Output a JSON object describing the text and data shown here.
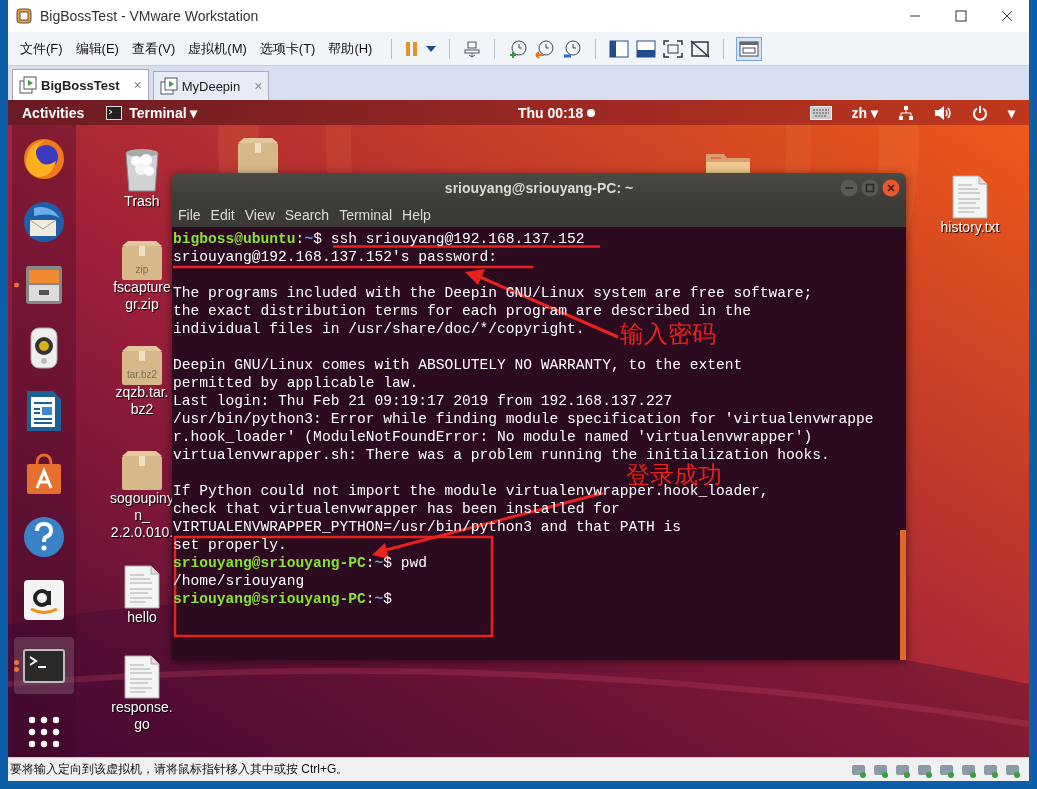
{
  "window": {
    "title": "BigBossTest - VMware Workstation"
  },
  "menu": [
    {
      "label": "文件(F)"
    },
    {
      "label": "编辑(E)"
    },
    {
      "label": "查看(V)"
    },
    {
      "label": "虚拟机(M)"
    },
    {
      "label": "选项卡(T)"
    },
    {
      "label": "帮助(H)"
    }
  ],
  "tabs": [
    {
      "label": "BigBossTest",
      "selected": true,
      "close": "×"
    },
    {
      "label": "MyDeepin",
      "selected": false,
      "close": "×"
    }
  ],
  "top_bar": {
    "activities": "Activities",
    "app_menu": "Terminal",
    "caret": "▾",
    "clock": "Thu 00:18",
    "input_method": "zh"
  },
  "dock": [
    {
      "kind": "firefox",
      "running": false,
      "active": false
    },
    {
      "kind": "mail",
      "running": false,
      "active": false
    },
    {
      "kind": "files",
      "running": true,
      "active": false
    },
    {
      "kind": "speaker",
      "running": false,
      "active": false
    },
    {
      "kind": "writer",
      "running": false,
      "active": false
    },
    {
      "kind": "store",
      "running": false,
      "active": false
    },
    {
      "kind": "help",
      "running": false,
      "active": false
    },
    {
      "kind": "amazon",
      "running": false,
      "active": false
    },
    {
      "kind": "terminal",
      "running": true,
      "active": true
    },
    {
      "kind": "grid",
      "running": false,
      "active": false
    }
  ],
  "desktop_icons": [
    {
      "kind": "trash",
      "label_lines": [
        "Trash"
      ]
    },
    {
      "kind": "zip",
      "badge": "zip",
      "label_lines": [
        "fscapture",
        "gr.zip"
      ]
    },
    {
      "kind": "zip",
      "badge": "tar.bz2",
      "label_lines": [
        "zqzb.tar.",
        "bz2"
      ]
    },
    {
      "kind": "zip",
      "label_lines": [
        "sogoupiny",
        "n_",
        "2.2.0.010."
      ]
    },
    {
      "kind": "text",
      "label_lines": [
        "hello"
      ]
    },
    {
      "kind": "text",
      "label_lines": [
        "response.",
        "go"
      ]
    },
    {
      "kind": "text",
      "label_lines": [
        "history.txt"
      ]
    }
  ],
  "terminal": {
    "title": "sriouyang@sriouyang-PC: ~",
    "menu": [
      {
        "label": "File"
      },
      {
        "label": "Edit"
      },
      {
        "label": "View"
      },
      {
        "label": "Search"
      },
      {
        "label": "Terminal"
      },
      {
        "label": "Help"
      }
    ],
    "lines": [
      {
        "kind": "prompt",
        "user_host": "bigboss@ubuntu",
        "separator": ":",
        "path": "~",
        "command": "$ ssh sriouyang@192.168.137.152"
      },
      {
        "kind": "output",
        "text": "sriouyang@192.168.137.152's password:"
      },
      {
        "kind": "blank"
      },
      {
        "kind": "output",
        "text": "The programs included with the Deepin GNU/Linux system are free software;"
      },
      {
        "kind": "output",
        "text": "the exact distribution terms for each program are described in the"
      },
      {
        "kind": "output",
        "text": "individual files in /usr/share/doc/*/copyright."
      },
      {
        "kind": "blank"
      },
      {
        "kind": "output",
        "text": "Deepin GNU/Linux comes with ABSOLUTELY NO WARRANTY, to the extent"
      },
      {
        "kind": "output",
        "text": "permitted by applicable law."
      },
      {
        "kind": "output",
        "text": "Last login: Thu Feb 21 09:19:17 2019 from 192.168.137.227"
      },
      {
        "kind": "output",
        "text": "/usr/bin/python3: Error while finding module specification for 'virtualenvwrappe"
      },
      {
        "kind": "output",
        "text": "r.hook_loader' (ModuleNotFoundError: No module named 'virtualenvwrapper')"
      },
      {
        "kind": "output",
        "text": "virtualenvwrapper.sh: There was a problem running the initialization hooks."
      },
      {
        "kind": "blank"
      },
      {
        "kind": "output",
        "text": "If Python could not import the module virtualenvwrapper.hook_loader,"
      },
      {
        "kind": "output",
        "text": "check that virtualenvwrapper has been installed for"
      },
      {
        "kind": "output",
        "text": "VIRTUALENVWRAPPER_PYTHON=/usr/bin/python3 and that PATH is"
      },
      {
        "kind": "output",
        "text": "set properly."
      },
      {
        "kind": "prompt",
        "user_host": "sriouyang@sriouyang-PC",
        "separator": ":",
        "path": "~",
        "command": "$ pwd"
      },
      {
        "kind": "output",
        "text": "/home/sriouyang"
      },
      {
        "kind": "prompt",
        "user_host": "sriouyang@sriouyang-PC",
        "separator": ":",
        "path": "~",
        "command": "$"
      }
    ]
  },
  "annotations": [
    {
      "text": "输入密码"
    },
    {
      "text": "登录成功"
    }
  ],
  "status_bar": {
    "text": "要将输入定向到该虚拟机，请将鼠标指针移入其中或按 Ctrl+G。"
  }
}
